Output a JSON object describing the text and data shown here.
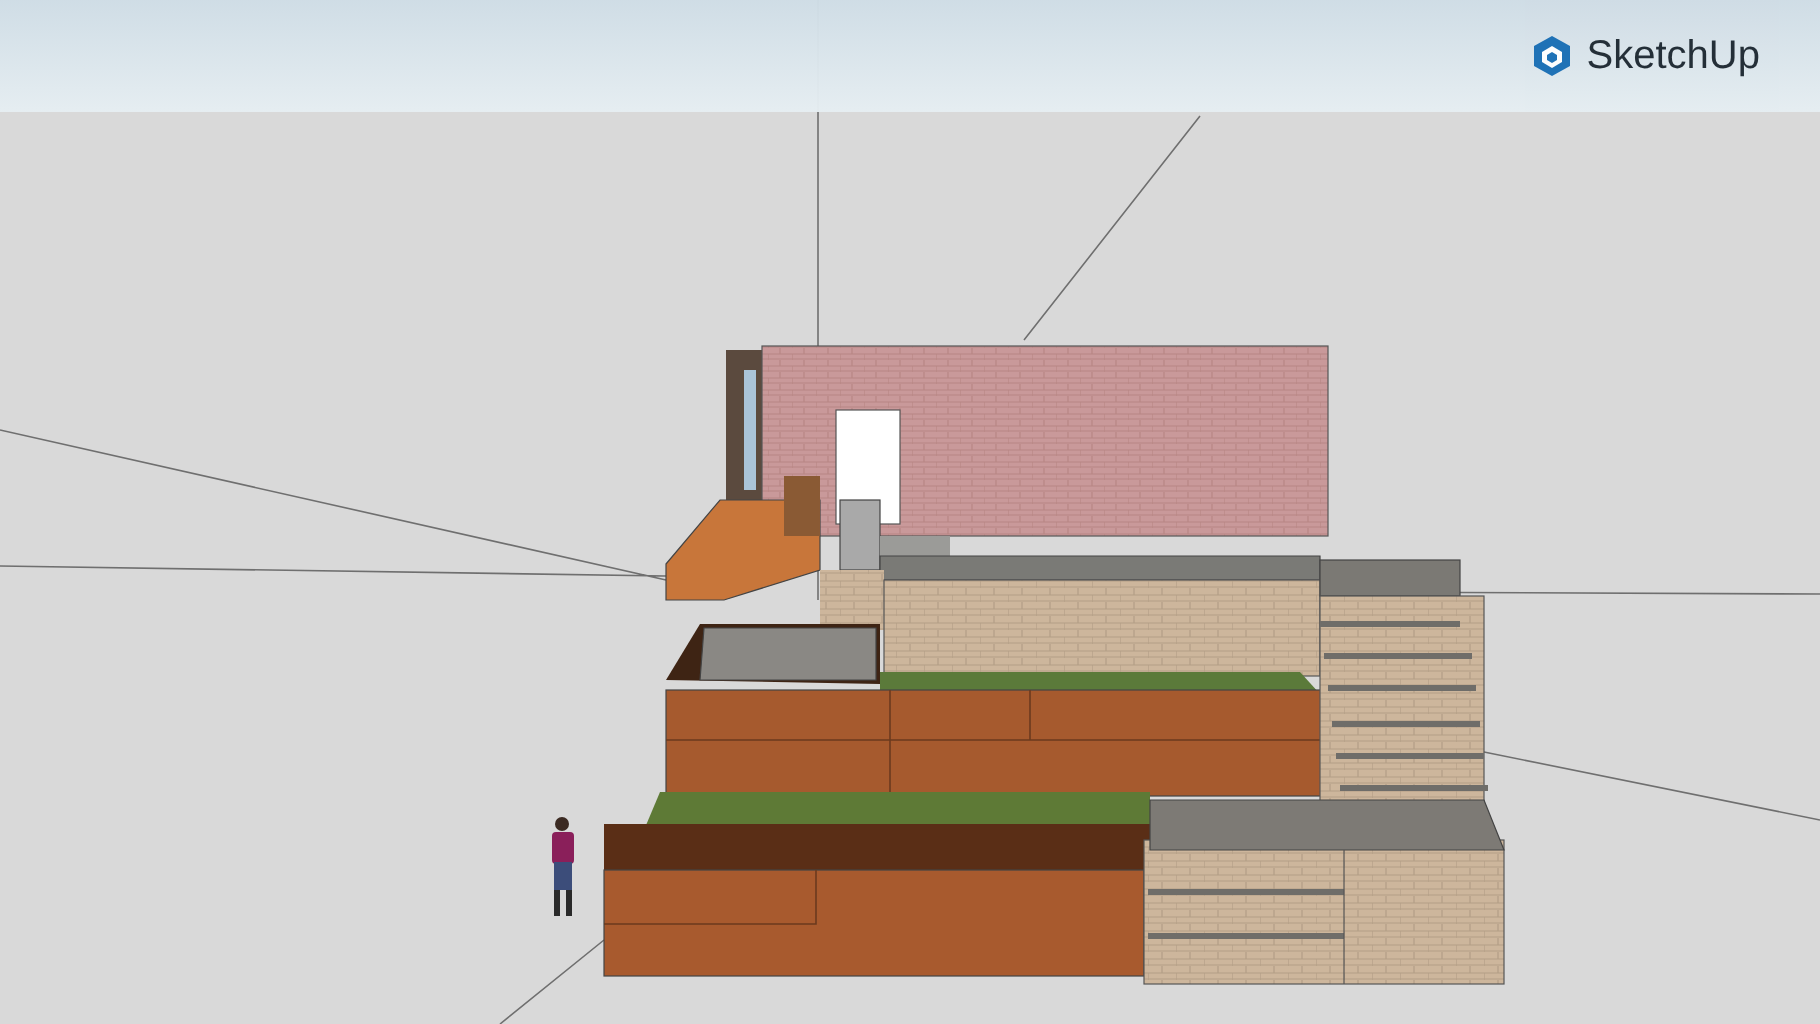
{
  "brand": {
    "name": "SketchUp"
  }
}
